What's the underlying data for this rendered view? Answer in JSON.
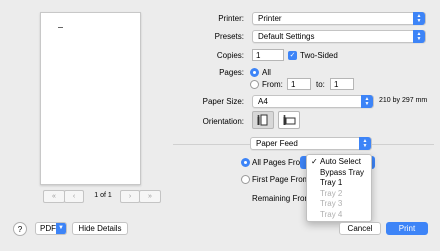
{
  "preview": {
    "pager_first": "«",
    "pager_prev": "‹",
    "page_indicator": "1 of 1",
    "pager_next": "›",
    "pager_last": "»"
  },
  "printer": {
    "label": "Printer:",
    "value": "Printer"
  },
  "presets": {
    "label": "Presets:",
    "value": "Default Settings"
  },
  "copies": {
    "label": "Copies:",
    "value": "1",
    "two_sided_label": "Two-Sided",
    "two_sided_checked": true
  },
  "pages": {
    "label": "Pages:",
    "all_label": "All",
    "from_label": "From:",
    "from_value": "1",
    "to_label": "to:",
    "to_value": "1",
    "selected": "All"
  },
  "paper_size": {
    "label": "Paper Size:",
    "value": "A4",
    "dimensions": "210 by 297 mm"
  },
  "orientation": {
    "label": "Orientation:",
    "selected": "portrait"
  },
  "section": {
    "value": "Paper Feed"
  },
  "paper_feed": {
    "all_pages_from_label": "All Pages From:",
    "first_page_from_label": "First Page From",
    "remaining_from_label": "Remaining From",
    "selected": "all_pages_from"
  },
  "source_menu": {
    "items": [
      {
        "label": "Auto Select",
        "checked": true,
        "enabled": true
      },
      {
        "label": "Bypass Tray",
        "checked": false,
        "enabled": true
      },
      {
        "label": "Tray 1",
        "checked": false,
        "enabled": true
      },
      {
        "label": "Tray 2",
        "checked": false,
        "enabled": false
      },
      {
        "label": "Tray 3",
        "checked": false,
        "enabled": false
      },
      {
        "label": "Tray 4",
        "checked": false,
        "enabled": false
      }
    ],
    "check_glyph": "✓"
  },
  "footer": {
    "help": "?",
    "pdf": "PDF",
    "hide_details": "Hide Details",
    "cancel": "Cancel",
    "print": "Print"
  },
  "colors": {
    "accent": "#3d84f7"
  },
  "icons": [
    "popup-arrows-icon",
    "check-icon",
    "portrait-orientation-icon",
    "landscape-orientation-icon",
    "help-icon",
    "chevron-down-icon"
  ]
}
